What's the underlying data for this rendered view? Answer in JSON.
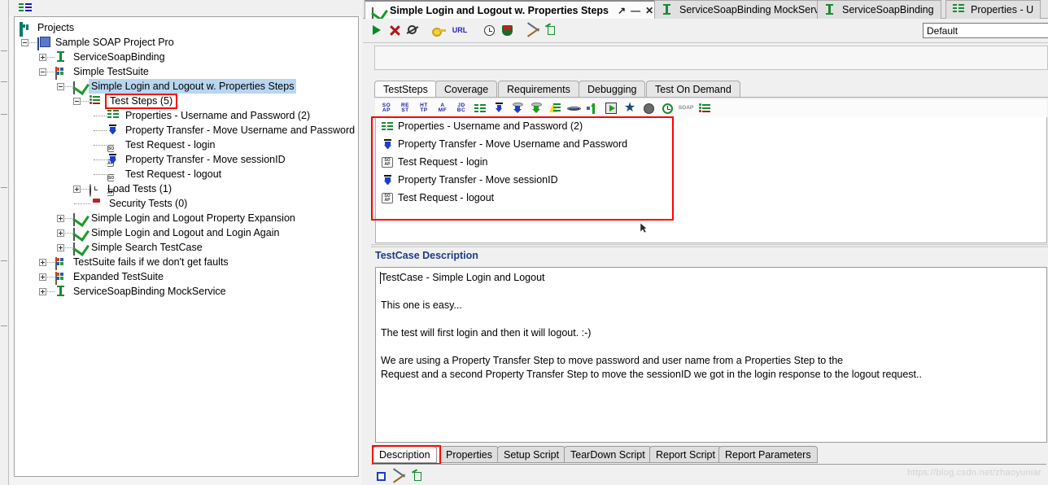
{
  "app": {
    "name": "SoapUI",
    "watermark": "https://blog.csdn.net/zhaoyuniar"
  },
  "left_toolbar": {
    "icon": "properties-list-icon"
  },
  "tree": {
    "root_label": "Projects",
    "root_icon": "projects-icon",
    "nodes": [
      {
        "label": "Sample SOAP Project Pro",
        "icon": "project-icon",
        "depth": 1,
        "toggle": "minus"
      },
      {
        "label": "ServiceSoapBinding",
        "icon": "interface-icon",
        "depth": 2,
        "toggle": "plus"
      },
      {
        "label": "Simple TestSuite",
        "icon": "testsuite-icon",
        "depth": 2,
        "toggle": "minus"
      },
      {
        "label": "Simple Login and Logout w. Properties Steps",
        "icon": "testcase-icon",
        "depth": 3,
        "toggle": "minus",
        "selected": true
      },
      {
        "label": "Test Steps (5)",
        "icon": "teststeps-icon",
        "depth": 4,
        "toggle": "minus",
        "highlighted": true
      },
      {
        "label": "Properties - Username and Password (2)",
        "icon": "properties-icon",
        "depth": 5,
        "toggle": "none"
      },
      {
        "label": "Property Transfer - Move Username and Password",
        "icon": "property-transfer-icon",
        "depth": 5,
        "toggle": "none"
      },
      {
        "label": "Test Request - login",
        "icon": "soap-request-icon",
        "depth": 5,
        "toggle": "none"
      },
      {
        "label": "Property Transfer - Move sessionID",
        "icon": "property-transfer-icon",
        "depth": 5,
        "toggle": "none"
      },
      {
        "label": "Test Request - logout",
        "icon": "soap-request-icon",
        "depth": 5,
        "toggle": "none"
      },
      {
        "label": "Load Tests (1)",
        "icon": "load-test-icon",
        "depth": 4,
        "toggle": "plus"
      },
      {
        "label": "Security Tests (0)",
        "icon": "security-test-icon",
        "depth": 4,
        "toggle": "none"
      },
      {
        "label": "Simple Login and Logout Property Expansion",
        "icon": "testcase-icon",
        "depth": 3,
        "toggle": "plus"
      },
      {
        "label": "Simple Login and Logout and Login Again",
        "icon": "testcase-icon",
        "depth": 3,
        "toggle": "plus"
      },
      {
        "label": "Simple Search TestCase",
        "icon": "testcase-icon",
        "depth": 3,
        "toggle": "plus"
      },
      {
        "label": "TestSuite fails if we don't get faults",
        "icon": "testsuite-icon",
        "depth": 2,
        "toggle": "plus"
      },
      {
        "label": "Expanded TestSuite",
        "icon": "testsuite-icon",
        "depth": 2,
        "toggle": "plus"
      },
      {
        "label": "ServiceSoapBinding MockService",
        "icon": "interface-icon",
        "depth": 2,
        "toggle": "plus"
      }
    ]
  },
  "window_tabs": [
    {
      "label": "Simple Login and Logout w. Properties Steps",
      "icon": "testcase-icon",
      "active": true,
      "controls": {
        "maximize": "↗",
        "minimize": "—",
        "close": "✕"
      }
    },
    {
      "label": "ServiceSoapBinding MockService",
      "icon": "interface-icon",
      "active": false
    },
    {
      "label": "ServiceSoapBinding",
      "icon": "interface-icon",
      "active": false
    },
    {
      "label": "Properties - U",
      "icon": "properties-icon",
      "active": false
    }
  ],
  "main_toolbar": {
    "buttons": [
      {
        "name": "run-button",
        "icon": "play-icon"
      },
      {
        "name": "cancel-button",
        "icon": "stop-x-icon"
      },
      {
        "name": "loop-button",
        "icon": "loop-icon"
      },
      {
        "name": "options-button",
        "icon": "key-icon"
      },
      {
        "name": "url-button",
        "icon": "url-icon",
        "text": "URL"
      },
      {
        "name": "testcase-options-button",
        "icon": "clock-icon"
      },
      {
        "name": "security-button",
        "icon": "shield-icon"
      },
      {
        "name": "tools-button",
        "icon": "tools-icon"
      },
      {
        "name": "clipboard-button",
        "icon": "clipboard-icon"
      }
    ],
    "environment": {
      "value": "Default",
      "name": "environment-select"
    }
  },
  "inner_tabs": [
    {
      "label": "TestSteps",
      "active": true
    },
    {
      "label": "Coverage",
      "active": false
    },
    {
      "label": "Requirements",
      "active": false
    },
    {
      "label": "Debugging",
      "active": false
    },
    {
      "label": "Test On Demand",
      "active": false
    }
  ],
  "steps_toolbar": [
    {
      "name": "add-soap-request-step",
      "icon": "soap-abbr-icon",
      "l1": "SO",
      "l2": "AP"
    },
    {
      "name": "add-rest-request-step",
      "icon": "rest-abbr-icon",
      "l1": "RE",
      "l2": "ST"
    },
    {
      "name": "add-http-request-step",
      "icon": "http-abbr-icon",
      "l1": "HT",
      "l2": "TP"
    },
    {
      "name": "add-amf-request-step",
      "icon": "amf-abbr-icon",
      "l1": "A",
      "l2": "MF"
    },
    {
      "name": "add-jdbc-request-step",
      "icon": "jdbc-abbr-icon",
      "l1": "JD",
      "l2": "BC"
    },
    {
      "name": "add-properties-step",
      "icon": "properties-icon"
    },
    {
      "name": "add-property-transfer-step",
      "icon": "property-transfer-icon"
    },
    {
      "name": "add-datasource-step",
      "icon": "datasource-icon"
    },
    {
      "name": "add-datasink-step",
      "icon": "datasink-icon"
    },
    {
      "name": "add-groovy-script-step",
      "icon": "groovy-script-icon"
    },
    {
      "name": "add-delay-step",
      "icon": "delay-icon"
    },
    {
      "name": "add-goto-step",
      "icon": "goto-icon"
    },
    {
      "name": "add-run-testcase-step",
      "icon": "run-testcase-icon"
    },
    {
      "name": "add-assertion-step",
      "icon": "assertion-star-icon"
    },
    {
      "name": "add-mock-response-step",
      "icon": "mock-response-icon"
    },
    {
      "name": "add-wait-step",
      "icon": "wait-clock-icon"
    },
    {
      "name": "add-manual-step",
      "icon": "soap-gray-icon",
      "l1": "SO",
      "l2": "AP"
    },
    {
      "name": "step-list-icon",
      "icon": "teststeps-icon"
    }
  ],
  "test_steps": [
    {
      "label": "Properties - Username and Password (2)",
      "icon": "properties-icon"
    },
    {
      "label": "Property Transfer - Move Username and Password",
      "icon": "property-transfer-icon"
    },
    {
      "label": "Test Request - login",
      "icon": "soap-request-icon"
    },
    {
      "label": "Property Transfer - Move sessionID",
      "icon": "property-transfer-icon"
    },
    {
      "label": "Test Request - logout",
      "icon": "soap-request-icon"
    }
  ],
  "description": {
    "header": "TestCase Description",
    "lines": [
      "TestCase - Simple Login and Logout",
      "",
      "This one is easy...",
      "",
      "The test will first login and then it will logout. :-)",
      "",
      "We are using a Property Transfer Step to move password and user name from a Properties Step to the",
      "Request and a second Property Transfer Step to move the sessionID we got in the login response to the logout request.."
    ]
  },
  "bottom_tabs": [
    {
      "label": "Description",
      "active": true,
      "highlighted": true
    },
    {
      "label": "Properties",
      "active": false
    },
    {
      "label": "Setup Script",
      "active": false
    },
    {
      "label": "TearDown Script",
      "active": false
    },
    {
      "label": "Report Script",
      "active": false
    },
    {
      "label": "Report Parameters",
      "active": false
    }
  ],
  "bottom_toolbar": [
    {
      "name": "square-button",
      "icon": "square-icon"
    },
    {
      "name": "tools-button",
      "icon": "tools-icon"
    },
    {
      "name": "clipboard-button",
      "icon": "clipboard-icon"
    }
  ],
  "colors": {
    "selection_blue": "#b8d6f0",
    "highlight_red": "#ff0000",
    "header_blue": "#1a3a8a",
    "green": "#1a9a2a"
  }
}
